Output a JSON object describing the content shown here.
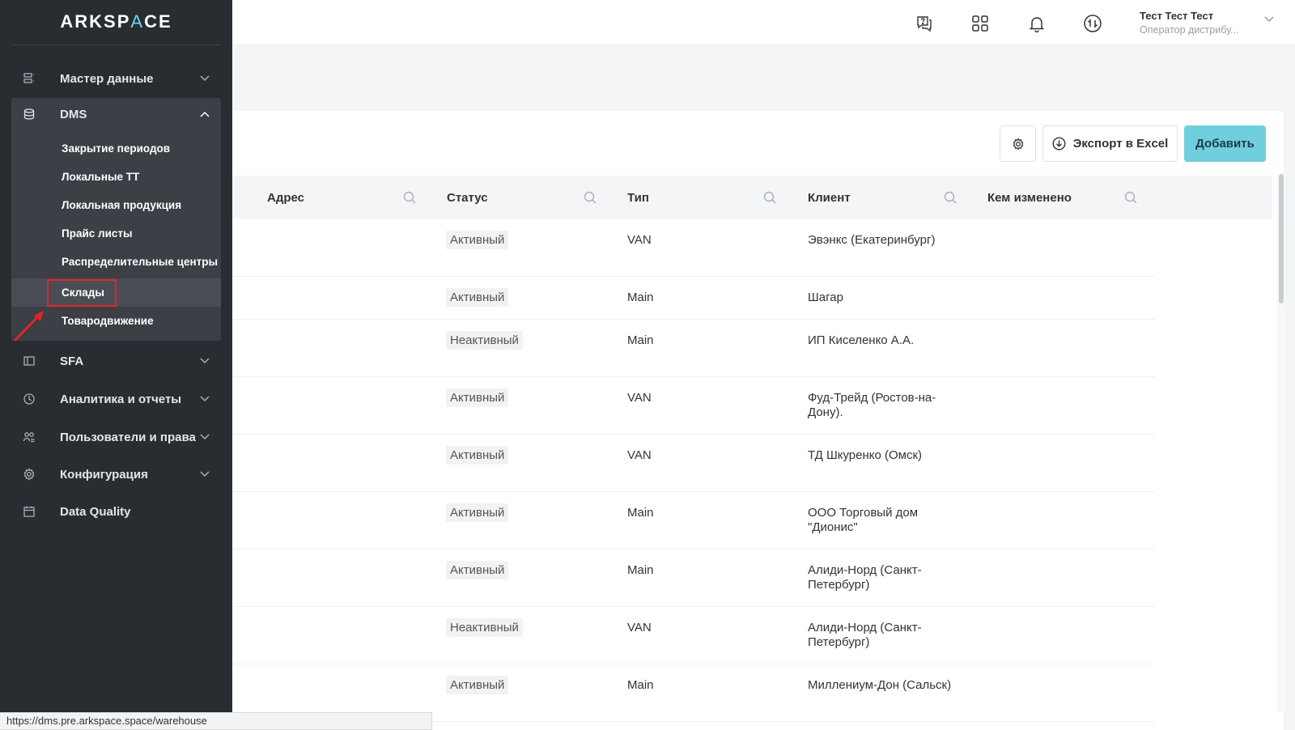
{
  "sidebar": {
    "logo_main": "ARKSP",
    "logo_accent": "A",
    "logo_tail": "CE",
    "items": [
      {
        "label": "Мастер данные",
        "icon": "master-data-icon"
      },
      {
        "label": "DMS",
        "icon": "database-icon"
      },
      {
        "label": "SFA",
        "icon": "sfa-icon"
      },
      {
        "label": "Аналитика и отчеты",
        "icon": "analytics-icon"
      },
      {
        "label": "Пользователи и права",
        "icon": "users-icon"
      },
      {
        "label": "Конфигурация",
        "icon": "gear-icon"
      },
      {
        "label": "Data Quality",
        "icon": "calendar-icon"
      }
    ],
    "dms_sub": [
      {
        "label": "Закрытие периодов"
      },
      {
        "label": "Локальные ТТ"
      },
      {
        "label": "Локальная продукция"
      },
      {
        "label": "Прайс листы"
      },
      {
        "label": "Распределительные центры"
      },
      {
        "label": "Склады"
      },
      {
        "label": "Товародвижение"
      }
    ]
  },
  "topbar": {
    "user_name": "Тест Тест Тест",
    "user_role": "Оператор дистрибу..."
  },
  "toolbar": {
    "export_label": "Экспорт в Excel",
    "add_label": "Добавить"
  },
  "table": {
    "columns": [
      "Адрес",
      "Статус",
      "Тип",
      "Клиент",
      "Кем изменено"
    ],
    "rows": [
      {
        "status": "Активный",
        "type": "VAN",
        "client": "Эвэнкс (Екатеринбург)"
      },
      {
        "status": "Активный",
        "type": "Main",
        "client": "Шагар"
      },
      {
        "status": "Неактивный",
        "type": "Main",
        "client": "ИП Киселенко А.А."
      },
      {
        "status": "Активный",
        "type": "VAN",
        "client": "Фуд-Трейд (Ростов-на-Дону)."
      },
      {
        "status": "Активный",
        "type": "VAN",
        "client": "ТД Шкуренко (Омск)"
      },
      {
        "status": "Активный",
        "type": "Main",
        "client": "ООО Торговый дом \"Дионис\""
      },
      {
        "status": "Активный",
        "type": "Main",
        "client": "Алиди-Норд (Санкт-Петербург)"
      },
      {
        "status": "Неактивный",
        "type": "VAN",
        "client": "Алиди-Норд (Санкт-Петербург)"
      },
      {
        "status": "Активный",
        "type": "Main",
        "client": "Миллениум-Дон (Сальск)"
      }
    ]
  },
  "statusbar": {
    "url": "https://dms.pre.arkspace.space/warehouse"
  },
  "colors": {
    "sidebar_bg": "#292c31",
    "accent": "#6fcfdc",
    "highlight": "#e5242a"
  }
}
